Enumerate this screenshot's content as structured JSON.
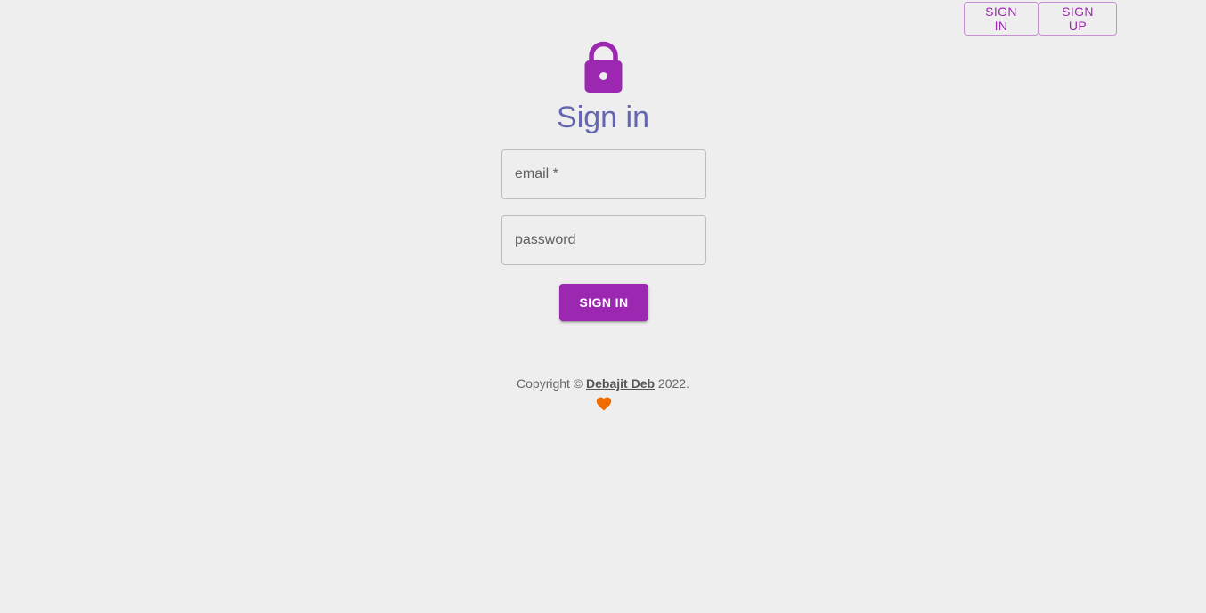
{
  "nav": {
    "signin_label": "SIGN IN",
    "signup_label": "SIGN UP"
  },
  "header": {
    "icon": "lock-icon",
    "title": "Sign in"
  },
  "form": {
    "email_placeholder": "email *",
    "email_value": "",
    "password_placeholder": "password",
    "password_value": "",
    "submit_label": "SIGN IN"
  },
  "footer": {
    "prefix": "Copyright © ",
    "author": "Debajit Deb",
    "suffix": " 2022.",
    "icon": "heart-icon"
  },
  "colors": {
    "accent": "#9c27b0",
    "title": "#6466b1",
    "heart": "#ef6c00",
    "background": "#eeeeee"
  }
}
